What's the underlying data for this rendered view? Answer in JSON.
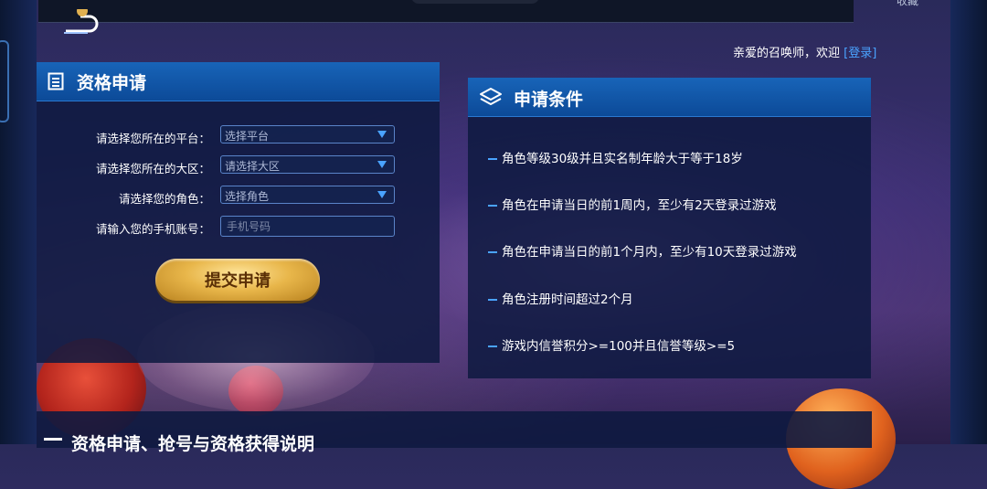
{
  "header": {
    "favorites_label": "收藏"
  },
  "welcome": {
    "greeting": "亲爱的召唤师，欢迎",
    "login_label": "[登录]"
  },
  "apply_panel": {
    "title": "资格申请",
    "platform": {
      "label": "请选择您所在的平台：",
      "value": "选择平台"
    },
    "region": {
      "label": "请选择您所在的大区：",
      "value": "请选择大区"
    },
    "role": {
      "label": "请选择您的角色：",
      "value": "选择角色"
    },
    "phone": {
      "label": "请输入您的手机账号：",
      "placeholder": "手机号码"
    },
    "submit_label": "提交申请"
  },
  "conditions_panel": {
    "title": "申请条件",
    "items": [
      "角色等级30级并且实名制年龄大于等于18岁",
      "角色在申请当日的前1周内，至少有2天登录过游戏",
      "角色在申请当日的前1个月内，至少有10天登录过游戏",
      "角色注册时间超过2个月",
      "游戏内信誉积分>=100并且信誉等级>=5"
    ]
  },
  "bottom_section": {
    "title": "资格申请、抢号与资格获得说明"
  },
  "colors": {
    "accent_blue": "#4aa3ff",
    "header_blue": "#1864b8",
    "button_gold": "#e8b64a"
  }
}
